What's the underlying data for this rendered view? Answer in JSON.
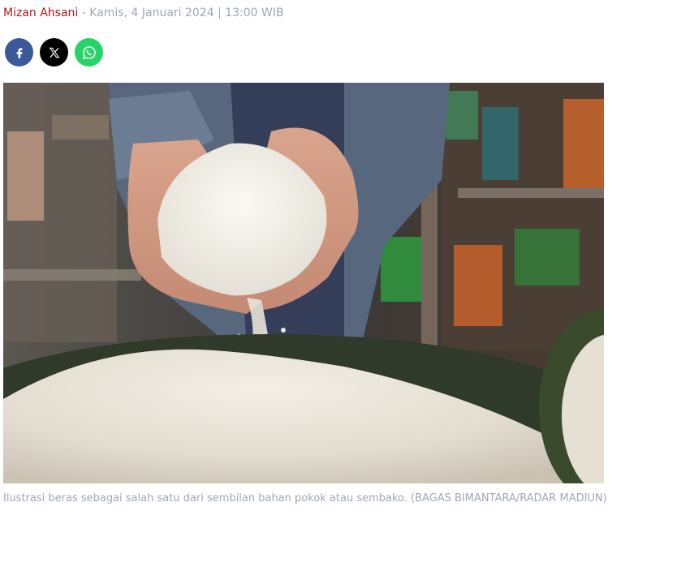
{
  "byline": {
    "author": "Mizan Ahsani",
    "separator": " - ",
    "datetime": "Kamis, 4 Januari 2024 | 13:00 WIB"
  },
  "share": {
    "buttons": [
      {
        "icon": "facebook-icon",
        "color": "#3b5998"
      },
      {
        "icon": "x-icon",
        "color": "#000000"
      },
      {
        "icon": "whatsapp-icon",
        "color": "#25d366"
      }
    ]
  },
  "photo": {
    "caption": "Ilustrasi beras sebagai salah satu dari sembilan bahan pokok atau sembako. (BAGAS BIMANTARA/RADAR MADIUN)"
  }
}
